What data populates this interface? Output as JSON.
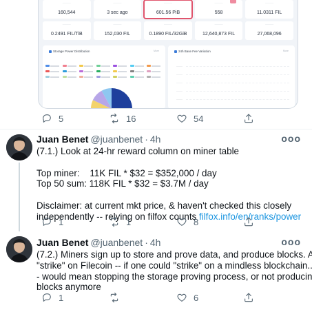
{
  "embed": {
    "stats_row1": [
      "160,544",
      "3 sec ago",
      "601.56 PiB",
      "558",
      "11.0311 FIL"
    ],
    "stats_row2": [
      "0.2491 FIL/TiB",
      "152,030 FIL",
      "0.1890 FIL/32GiB",
      "12,640,873 FIL",
      "27,068,096"
    ],
    "highlight_color": "#e0546c",
    "panel_left_title": "Storage Power Distribution",
    "panel_right_title": "24h Base Fee Variation",
    "more_label": "More",
    "pie_slices": [
      {
        "color": "#1e3f9c",
        "fraction": 0.42
      },
      {
        "color": "#f2a8c1",
        "fraction": 0.18
      },
      {
        "color": "#6fd0c4",
        "fraction": 0.12
      },
      {
        "color": "#f3d36c",
        "fraction": 0.1
      },
      {
        "color": "#b7a6e8",
        "fraction": 0.1
      },
      {
        "color": "#8ec7f0",
        "fraction": 0.08
      }
    ],
    "legend_colors": [
      "#4f8de8",
      "#f07f8f",
      "#f2c94c",
      "#6fcf97",
      "#9b51e0",
      "#56ccf2",
      "#f2994a",
      "#eb5757",
      "#2d9cdb",
      "#bb6bd9",
      "#27ae60",
      "#f2c94c",
      "#828282",
      "#e0a0c0",
      "#a0d0e0",
      "#c0e0a0",
      "#f0b0a0",
      "#a0a0e0",
      "#d0d060",
      "#60d0b0",
      "#b0b0b0"
    ]
  },
  "tweet0": {
    "actions": {
      "reply": "5",
      "retweet": "16",
      "like": "54"
    }
  },
  "tweet1": {
    "name": "Juan Benet",
    "handle": "@juanbenet",
    "dot": "·",
    "time": "4h",
    "more": "ooo",
    "lines": [
      "(7.1.) Look at 24-hr reward column on miner table",
      "",
      "Top miner:    11K FIL * $32 = $352,000 / day",
      "Top 50 sum: 118K FIL * $32 = $3.7M / day",
      "",
      "Disclaimer: at current mkt price, & haven't checked this closely",
      "independently -- relying on filfox counts "
    ],
    "link": "filfox.info/en/ranks/power",
    "actions": {
      "reply": "1",
      "retweet": "1",
      "like": "8"
    }
  },
  "tweet2": {
    "name": "Juan Benet",
    "handle": "@juanbenet",
    "dot": "·",
    "time": "4h",
    "more": "ooo",
    "lines": [
      "(7.2.) Miners sign up to store and prove data, and produce blocks. A",
      "\"strike\" on Filecoin -- if one could \"strike\" on a mindless blockchain... -",
      "- would mean stopping the storage proving process, or not producing",
      "blocks anymore"
    ],
    "actions": {
      "reply": "1",
      "retweet": "",
      "like": "6"
    }
  }
}
